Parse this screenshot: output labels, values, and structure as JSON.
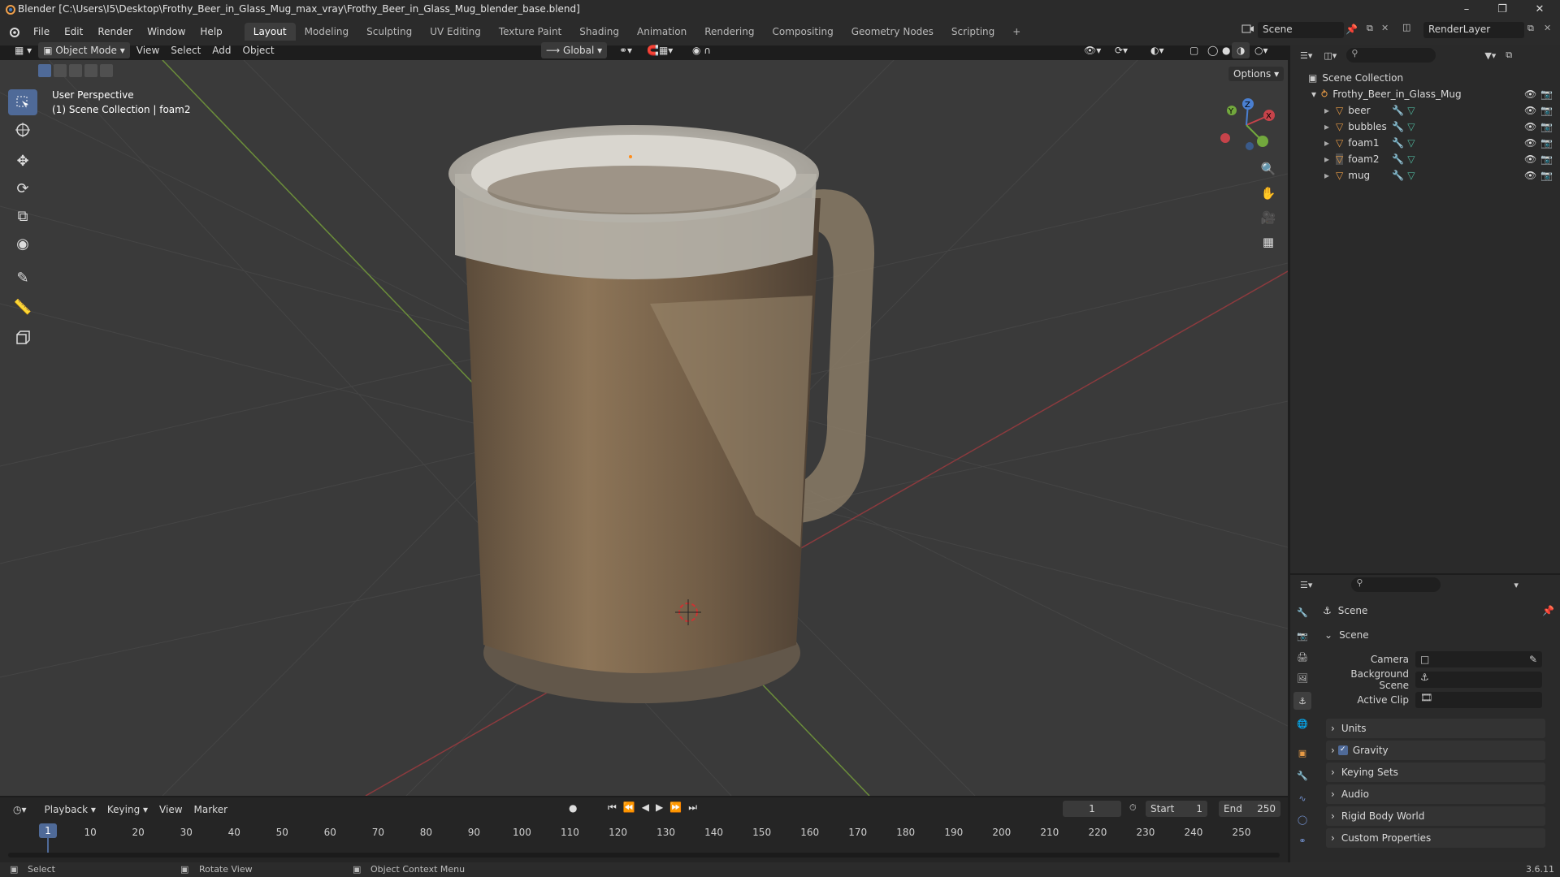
{
  "window": {
    "title": "Blender [C:\\Users\\I5\\Desktop\\Frothy_Beer_in_Glass_Mug_max_vray\\Frothy_Beer_in_Glass_Mug_blender_base.blend]"
  },
  "menus": [
    "File",
    "Edit",
    "Render",
    "Window",
    "Help"
  ],
  "workspaces": [
    "Layout",
    "Modeling",
    "Sculpting",
    "UV Editing",
    "Texture Paint",
    "Shading",
    "Animation",
    "Rendering",
    "Compositing",
    "Geometry Nodes",
    "Scripting"
  ],
  "active_workspace": "Layout",
  "scene_name": "Scene",
  "view_layer": "RenderLayer",
  "viewport_header": {
    "mode": "Object Mode",
    "menus": [
      "View",
      "Select",
      "Add",
      "Object"
    ],
    "orientation": "Global",
    "options_label": "Options"
  },
  "viewport": {
    "perspective": "User Perspective",
    "collection_info": "(1) Scene Collection | foam2"
  },
  "outliner": {
    "root": "Scene Collection",
    "collection": "Frothy_Beer_in_Glass_Mug",
    "objects": [
      "beer",
      "bubbles",
      "foam1",
      "foam2",
      "mug"
    ]
  },
  "properties": {
    "context": "Scene",
    "panel": "Scene",
    "fields": {
      "camera": "Camera",
      "background_scene": "Background Scene",
      "active_clip": "Active Clip"
    },
    "subpanels": [
      "Units",
      "Gravity",
      "Keying Sets",
      "Audio",
      "Rigid Body World",
      "Custom Properties"
    ],
    "gravity_checked": true
  },
  "timeline": {
    "menus": [
      "Playback",
      "Keying",
      "View",
      "Marker"
    ],
    "current_frame": "1",
    "start_label": "Start",
    "start": "1",
    "end_label": "End",
    "end": "250",
    "ticks": [
      "1",
      "10",
      "20",
      "30",
      "40",
      "50",
      "60",
      "70",
      "80",
      "90",
      "100",
      "110",
      "120",
      "130",
      "140",
      "150",
      "160",
      "170",
      "180",
      "190",
      "200",
      "210",
      "220",
      "230",
      "240",
      "250"
    ]
  },
  "statusbar": {
    "select": "Select",
    "rotate": "Rotate View",
    "context_menu": "Object Context Menu",
    "version": "3.6.11"
  },
  "colors": {
    "accent": "#4f6a98",
    "x_axis": "#c6434a",
    "y_axis": "#72a83d",
    "z_axis": "#4a7fd0",
    "object_icon": "#e79a45"
  }
}
